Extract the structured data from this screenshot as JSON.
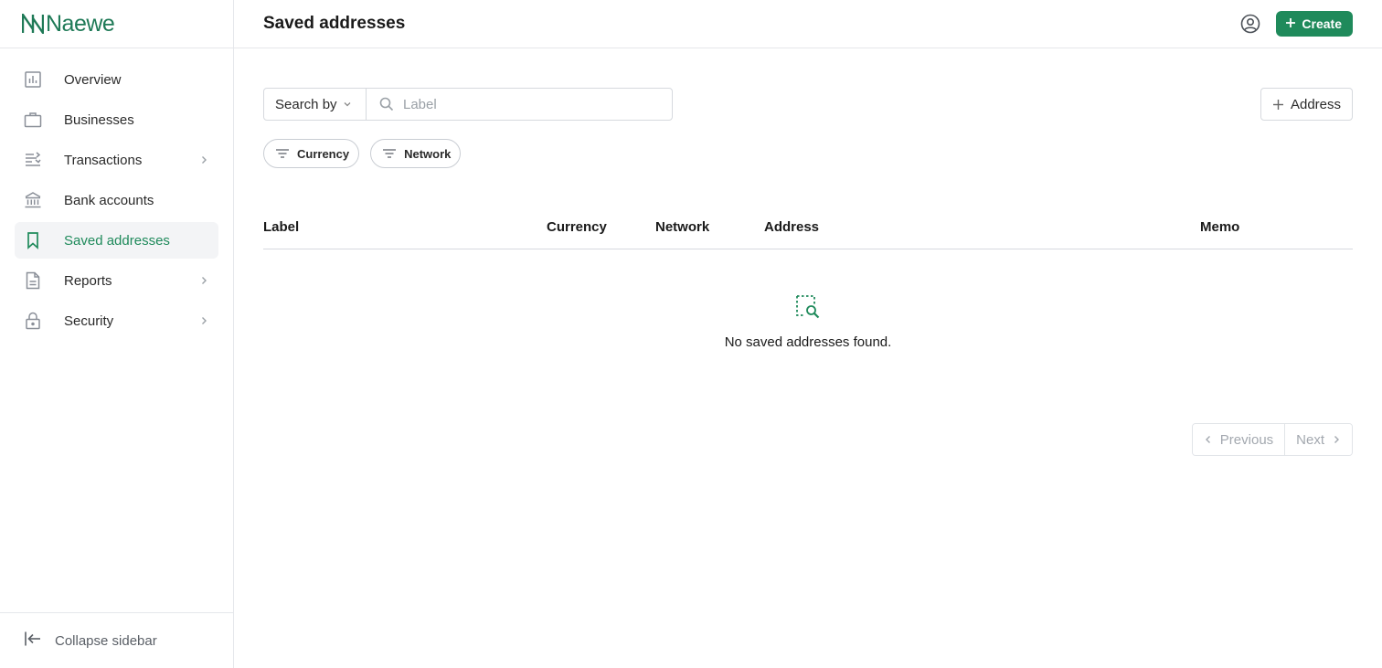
{
  "brand": {
    "name": "Naewe",
    "color": "#1f7a57"
  },
  "sidebar": {
    "items": [
      {
        "label": "Overview",
        "icon": "bar-chart-icon",
        "has_chevron": false,
        "active": false
      },
      {
        "label": "Businesses",
        "icon": "briefcase-icon",
        "has_chevron": false,
        "active": false
      },
      {
        "label": "Transactions",
        "icon": "transactions-icon",
        "has_chevron": true,
        "active": false
      },
      {
        "label": "Bank accounts",
        "icon": "bank-icon",
        "has_chevron": false,
        "active": false
      },
      {
        "label": "Saved addresses",
        "icon": "bookmark-icon",
        "has_chevron": false,
        "active": true
      },
      {
        "label": "Reports",
        "icon": "document-icon",
        "has_chevron": true,
        "active": false
      },
      {
        "label": "Security",
        "icon": "lock-icon",
        "has_chevron": true,
        "active": false
      }
    ],
    "collapse_label": "Collapse sidebar"
  },
  "header": {
    "title": "Saved addresses",
    "create_label": "Create",
    "accent": "#1f8a5b"
  },
  "toolbar": {
    "search_by_label": "Search by",
    "search_placeholder": "Label",
    "add_address_label": "Address"
  },
  "filters": [
    {
      "label": "Currency"
    },
    {
      "label": "Network"
    }
  ],
  "table": {
    "columns": [
      "Label",
      "Currency",
      "Network",
      "Address",
      "Memo"
    ],
    "rows": [],
    "empty_message": "No saved addresses found."
  },
  "pagination": {
    "previous_label": "Previous",
    "next_label": "Next"
  }
}
